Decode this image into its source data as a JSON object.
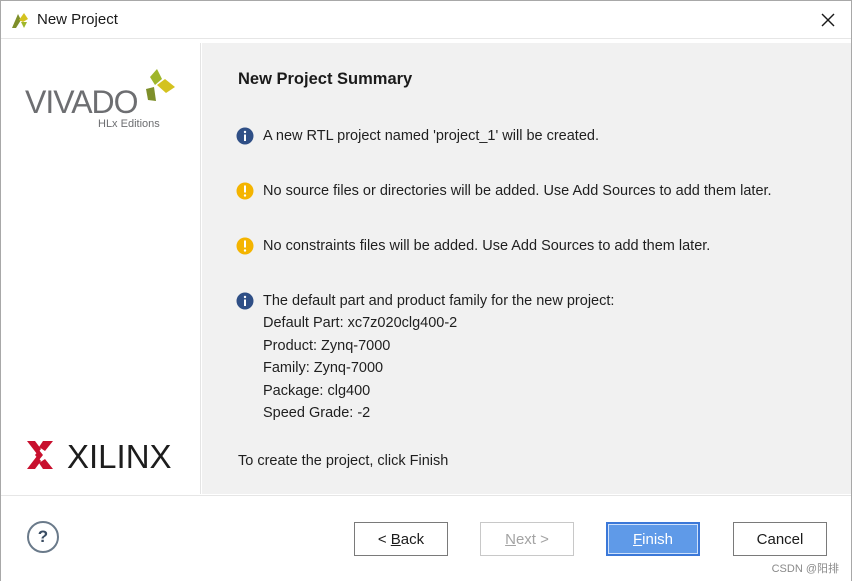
{
  "window": {
    "title": "New Project"
  },
  "branding": {
    "product": "VIVADO",
    "edition": "HLx Editions",
    "company": "XILINX"
  },
  "summary": {
    "heading": "New Project Summary",
    "messages": [
      {
        "icon": "info-icon",
        "text": "A new RTL project named 'project_1' will be created."
      },
      {
        "icon": "warning-icon",
        "text": "No source files or directories will be added. Use Add Sources to add them later."
      },
      {
        "icon": "warning-icon",
        "text": "No constraints files will be added. Use Add Sources to add them later."
      }
    ],
    "part_info": {
      "icon": "info-icon",
      "intro": "The default part and product family for the new project:",
      "default_part": "Default Part: xc7z020clg400-2",
      "product": "Product: Zynq-7000",
      "family": "Family: Zynq-7000",
      "package": "Package: clg400",
      "speed_grade": "Speed Grade: -2"
    },
    "footer": "To create the project, click Finish"
  },
  "buttons": {
    "help": "?",
    "back_prefix": "< ",
    "back_mnemonic": "B",
    "back_rest": "ack",
    "next_mnemonic": "N",
    "next_rest": "ext >",
    "finish_mnemonic": "F",
    "finish_rest": "inish",
    "cancel": "Cancel"
  },
  "watermark": "CSDN @阳排",
  "colors": {
    "info": "#2f4f86",
    "warning": "#f4b400",
    "primary_button": "#5f9ae8",
    "panel_bg": "#f1f1f1"
  }
}
